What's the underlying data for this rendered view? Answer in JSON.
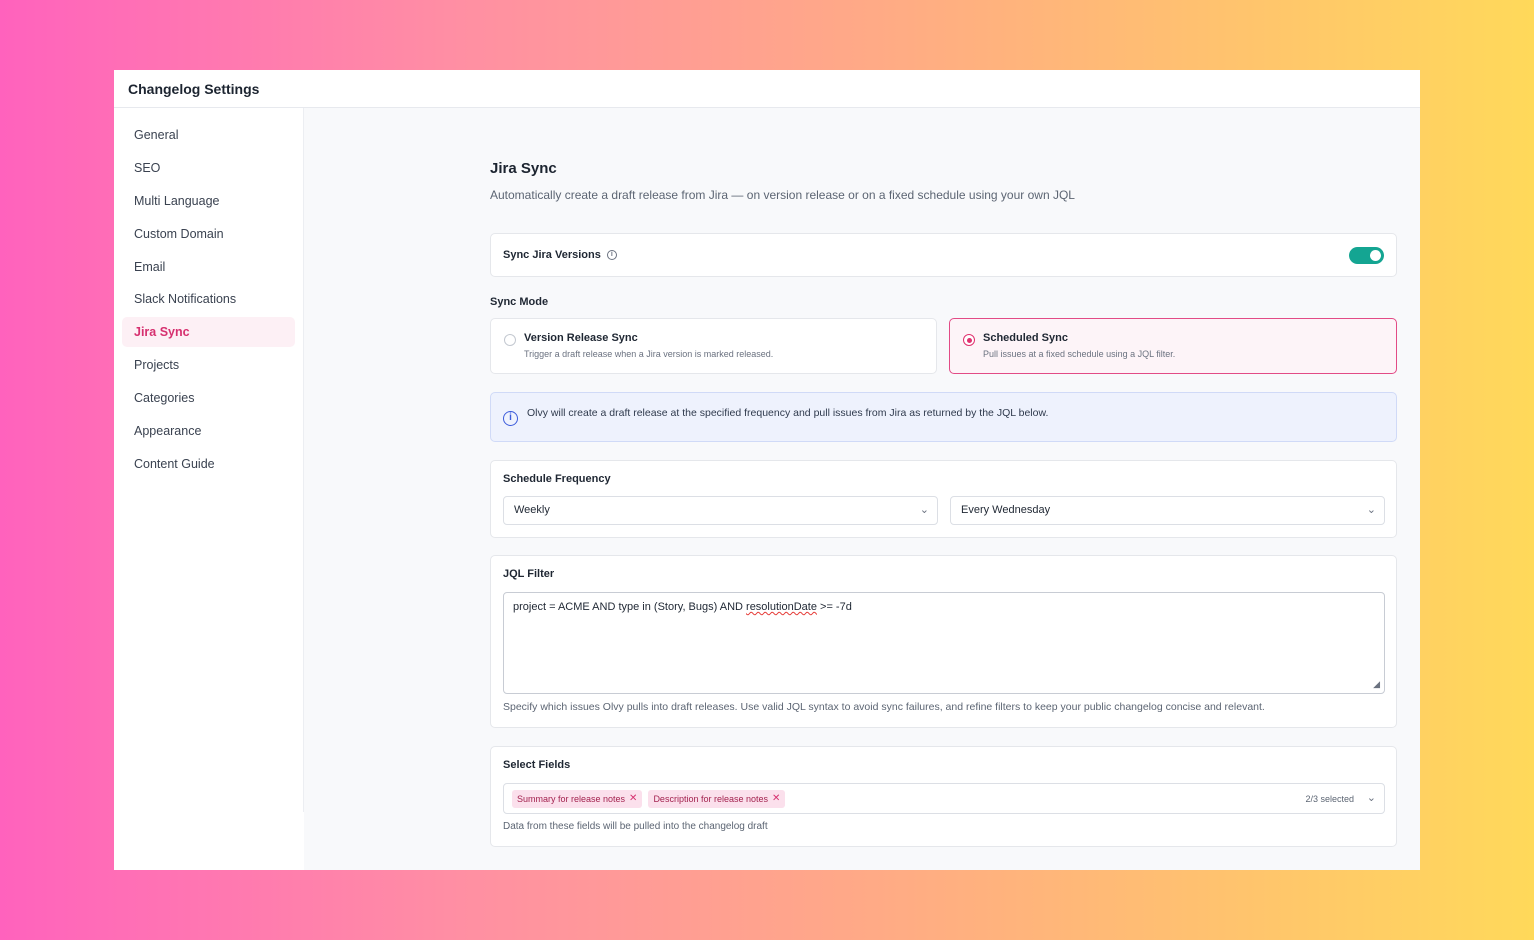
{
  "window": {
    "title": "Changelog Settings"
  },
  "sidebar": {
    "items": [
      {
        "label": "General"
      },
      {
        "label": "SEO"
      },
      {
        "label": "Multi Language"
      },
      {
        "label": "Custom Domain"
      },
      {
        "label": "Email"
      },
      {
        "label": "Slack Notifications"
      },
      {
        "label": "Jira Sync",
        "active": true
      },
      {
        "label": "Projects"
      },
      {
        "label": "Categories"
      },
      {
        "label": "Appearance"
      },
      {
        "label": "Content Guide"
      }
    ]
  },
  "page": {
    "title": "Jira Sync",
    "subtitle": "Automatically create a draft release from Jira — on version release or on a fixed schedule using your own JQL"
  },
  "sync_versions": {
    "label": "Sync Jira Versions",
    "info_icon": "info-icon",
    "enabled": true,
    "accent": "#14a592"
  },
  "sync_mode": {
    "label": "Sync Mode",
    "options": [
      {
        "title": "Version Release Sync",
        "desc": "Trigger a draft release when a Jira version is marked released.",
        "selected": false
      },
      {
        "title": "Scheduled Sync",
        "desc": "Pull issues at a fixed schedule using a JQL filter.",
        "selected": true
      }
    ],
    "accent": "#e0306f"
  },
  "banner": {
    "icon": "info-icon",
    "text": "Olvy will create a draft release at the specified frequency and pull issues from Jira as returned by the JQL below."
  },
  "schedule": {
    "label": "Schedule Frequency",
    "frequency": "Weekly",
    "day": "Every Wednesday"
  },
  "jql": {
    "label": "JQL Filter",
    "value_before": "project = ACME AND type in (Story, Bugs) AND ",
    "value_flagged": "resolutionDate",
    "value_after": " >= -7d",
    "help": "Specify which issues Olvy pulls into draft releases. Use valid JQL syntax to avoid sync failures, and refine filters to keep your public changelog concise and relevant."
  },
  "fields": {
    "label": "Select Fields",
    "chips": [
      {
        "label": "Summary for release notes"
      },
      {
        "label": "Description for release notes"
      }
    ],
    "count": "2/3 selected",
    "help": "Data from these fields will be pulled into the changelog draft"
  }
}
